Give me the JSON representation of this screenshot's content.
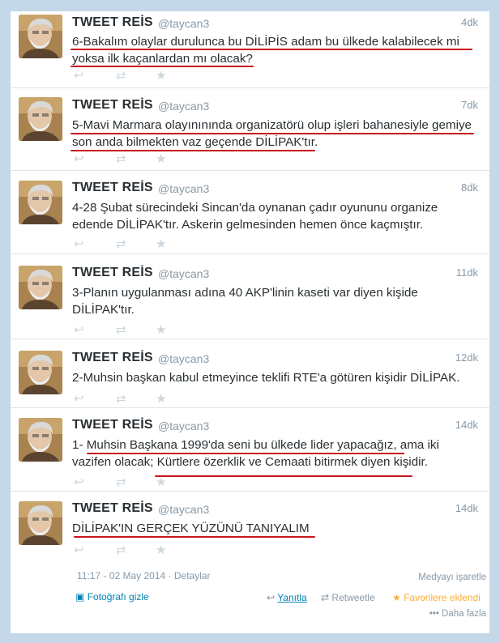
{
  "tweets": [
    {
      "name": "TWEET REİS",
      "handle": "@taycan3",
      "time": "4dk",
      "lines": [
        "6-Bakalım olaylar durulunca bu DİLİPİS adam bu ülkede kalabilecek mi",
        "yoksa ilk kaçanlardan mı olacak?"
      ]
    },
    {
      "name": "TWEET REİS",
      "handle": "@taycan3",
      "time": "7dk",
      "lines": [
        "5-Mavi Marmara olayınınında organizatörü olup işleri bahanesiyle gemiye",
        "son anda bilmekten vaz geçende DİLİPAK'tır."
      ]
    },
    {
      "name": "TWEET REİS",
      "handle": "@taycan3",
      "time": "8dk",
      "lines": [
        "4-28 Şubat sürecindeki Sincan'da oynanan çadır oyununu organize",
        "edende DİLİPAK'tır. Askerin gelmesinden hemen önce kaçmıştır."
      ]
    },
    {
      "name": "TWEET REİS",
      "handle": "@taycan3",
      "time": "11dk",
      "lines": [
        "3-Planın uygulanması adına 40 AKP'linin kaseti var diyen kişide",
        "DİLİPAK'tır."
      ]
    },
    {
      "name": "TWEET REİS",
      "handle": "@taycan3",
      "time": "12dk",
      "lines": [
        "2-Muhsin başkan kabul etmeyince teklifi RTE'a götüren kişidir DİLİPAK."
      ]
    },
    {
      "name": "TWEET REİS",
      "handle": "@taycan3",
      "time": "14dk",
      "lines": [
        "1- Muhsin Başkana 1999'da seni bu ülkede lider yapacağız, ama iki",
        "vazifen olacak; Kürtlere özerklik ve Cemaati bitirmek diyen kişidir."
      ]
    },
    {
      "name": "TWEET REİS",
      "handle": "@taycan3",
      "time": "14dk",
      "lines": [
        "DİLİPAK'IN GERÇEK YÜZÜNÜ TANIYALIM"
      ]
    }
  ],
  "footer": {
    "timestamp": "11:17 - 02 May 2014 · Detaylar",
    "media_flag": "Medyayı işaretle",
    "hide_photo": "Fotoğrafı gizle",
    "reply": "Yanıtla",
    "retweet": "Retweetle",
    "favorited": "Favorilere eklendi",
    "more": "Daha fazla"
  },
  "icons": {
    "reply": "reply-icon",
    "retweet": "retweet-icon",
    "favorite": "star-icon",
    "photo": "photo-icon",
    "more": "more-dots-icon"
  },
  "colors": {
    "link": "#0084b4",
    "muted": "#8899a6",
    "favorite": "#ffac33",
    "annotation": "#c8141c",
    "background": "#c5d8ea"
  }
}
